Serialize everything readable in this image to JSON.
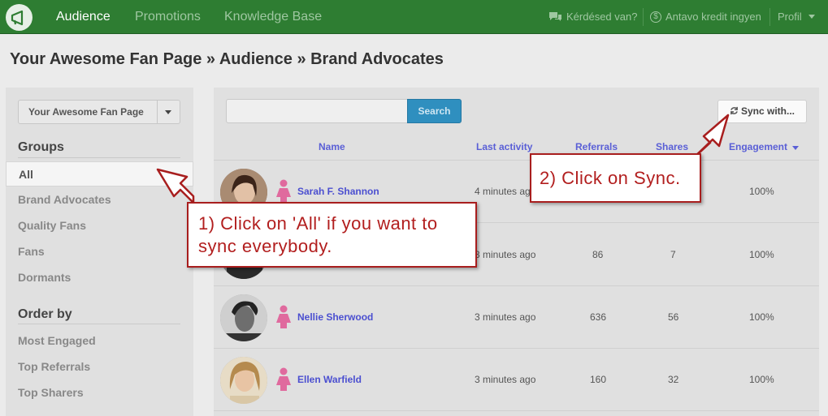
{
  "nav": {
    "items": [
      {
        "label": "Audience"
      },
      {
        "label": "Promotions"
      },
      {
        "label": "Knowledge Base"
      }
    ],
    "right": {
      "question": "Kérdésed van?",
      "credit": "Antavo kredit ingyen",
      "profile": "Profil"
    }
  },
  "page": {
    "title": "Your Awesome Fan Page » Audience » Brand Advocates"
  },
  "sidebar": {
    "page_select": "Your Awesome Fan Page",
    "groups_heading": "Groups",
    "groups": [
      {
        "label": "All"
      },
      {
        "label": "Brand Advocates"
      },
      {
        "label": "Quality Fans"
      },
      {
        "label": "Fans"
      },
      {
        "label": "Dormants"
      }
    ],
    "order_heading": "Order by",
    "order": [
      {
        "label": "Most Engaged"
      },
      {
        "label": "Top Referrals"
      },
      {
        "label": "Top Sharers"
      }
    ]
  },
  "toolbar": {
    "search_placeholder": "",
    "search_label": "Search",
    "sync_label": "Sync with..."
  },
  "table": {
    "columns": {
      "name": "Name",
      "last_activity": "Last activity",
      "referrals": "Referrals",
      "shares": "Shares",
      "engagement": "Engagement"
    },
    "rows": [
      {
        "name": "Sarah F. Shannon",
        "last": "4 minutes ago",
        "referrals": "",
        "shares": "",
        "engagement": "100%"
      },
      {
        "name": "",
        "last": "3 minutes ago",
        "referrals": "86",
        "shares": "7",
        "engagement": "100%"
      },
      {
        "name": "Nellie Sherwood",
        "last": "3 minutes ago",
        "referrals": "636",
        "shares": "56",
        "engagement": "100%"
      },
      {
        "name": "Ellen Warfield",
        "last": "3 minutes ago",
        "referrals": "160",
        "shares": "32",
        "engagement": "100%"
      }
    ]
  },
  "callouts": {
    "one": "1) Click on 'All' if you want to sync everybody.",
    "two": "2) Click on Sync."
  },
  "colors": {
    "navbar": "#2e7d32",
    "link": "#4b4fd0",
    "search_button": "#2f8fbf",
    "callout_border": "#a81e1e",
    "female_icon": "#e06a9e"
  }
}
